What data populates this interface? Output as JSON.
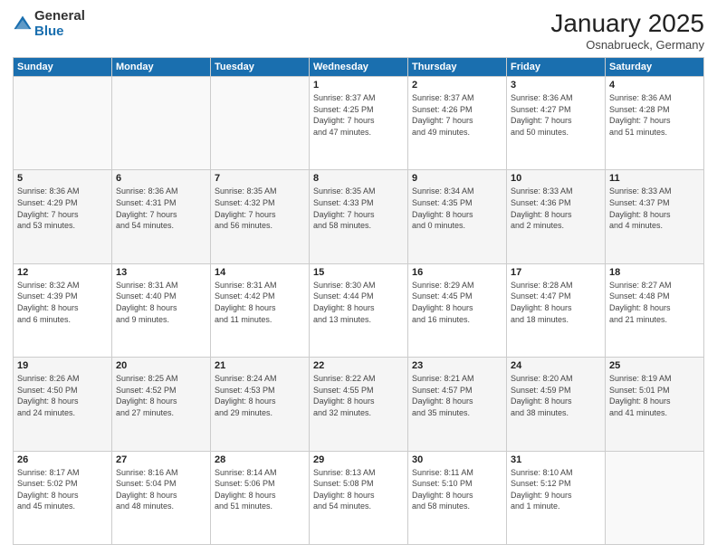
{
  "logo": {
    "general": "General",
    "blue": "Blue"
  },
  "title": "January 2025",
  "location": "Osnabrueck, Germany",
  "days_header": [
    "Sunday",
    "Monday",
    "Tuesday",
    "Wednesday",
    "Thursday",
    "Friday",
    "Saturday"
  ],
  "weeks": [
    [
      {
        "day": "",
        "info": ""
      },
      {
        "day": "",
        "info": ""
      },
      {
        "day": "",
        "info": ""
      },
      {
        "day": "1",
        "info": "Sunrise: 8:37 AM\nSunset: 4:25 PM\nDaylight: 7 hours\nand 47 minutes."
      },
      {
        "day": "2",
        "info": "Sunrise: 8:37 AM\nSunset: 4:26 PM\nDaylight: 7 hours\nand 49 minutes."
      },
      {
        "day": "3",
        "info": "Sunrise: 8:36 AM\nSunset: 4:27 PM\nDaylight: 7 hours\nand 50 minutes."
      },
      {
        "day": "4",
        "info": "Sunrise: 8:36 AM\nSunset: 4:28 PM\nDaylight: 7 hours\nand 51 minutes."
      }
    ],
    [
      {
        "day": "5",
        "info": "Sunrise: 8:36 AM\nSunset: 4:29 PM\nDaylight: 7 hours\nand 53 minutes."
      },
      {
        "day": "6",
        "info": "Sunrise: 8:36 AM\nSunset: 4:31 PM\nDaylight: 7 hours\nand 54 minutes."
      },
      {
        "day": "7",
        "info": "Sunrise: 8:35 AM\nSunset: 4:32 PM\nDaylight: 7 hours\nand 56 minutes."
      },
      {
        "day": "8",
        "info": "Sunrise: 8:35 AM\nSunset: 4:33 PM\nDaylight: 7 hours\nand 58 minutes."
      },
      {
        "day": "9",
        "info": "Sunrise: 8:34 AM\nSunset: 4:35 PM\nDaylight: 8 hours\nand 0 minutes."
      },
      {
        "day": "10",
        "info": "Sunrise: 8:33 AM\nSunset: 4:36 PM\nDaylight: 8 hours\nand 2 minutes."
      },
      {
        "day": "11",
        "info": "Sunrise: 8:33 AM\nSunset: 4:37 PM\nDaylight: 8 hours\nand 4 minutes."
      }
    ],
    [
      {
        "day": "12",
        "info": "Sunrise: 8:32 AM\nSunset: 4:39 PM\nDaylight: 8 hours\nand 6 minutes."
      },
      {
        "day": "13",
        "info": "Sunrise: 8:31 AM\nSunset: 4:40 PM\nDaylight: 8 hours\nand 9 minutes."
      },
      {
        "day": "14",
        "info": "Sunrise: 8:31 AM\nSunset: 4:42 PM\nDaylight: 8 hours\nand 11 minutes."
      },
      {
        "day": "15",
        "info": "Sunrise: 8:30 AM\nSunset: 4:44 PM\nDaylight: 8 hours\nand 13 minutes."
      },
      {
        "day": "16",
        "info": "Sunrise: 8:29 AM\nSunset: 4:45 PM\nDaylight: 8 hours\nand 16 minutes."
      },
      {
        "day": "17",
        "info": "Sunrise: 8:28 AM\nSunset: 4:47 PM\nDaylight: 8 hours\nand 18 minutes."
      },
      {
        "day": "18",
        "info": "Sunrise: 8:27 AM\nSunset: 4:48 PM\nDaylight: 8 hours\nand 21 minutes."
      }
    ],
    [
      {
        "day": "19",
        "info": "Sunrise: 8:26 AM\nSunset: 4:50 PM\nDaylight: 8 hours\nand 24 minutes."
      },
      {
        "day": "20",
        "info": "Sunrise: 8:25 AM\nSunset: 4:52 PM\nDaylight: 8 hours\nand 27 minutes."
      },
      {
        "day": "21",
        "info": "Sunrise: 8:24 AM\nSunset: 4:53 PM\nDaylight: 8 hours\nand 29 minutes."
      },
      {
        "day": "22",
        "info": "Sunrise: 8:22 AM\nSunset: 4:55 PM\nDaylight: 8 hours\nand 32 minutes."
      },
      {
        "day": "23",
        "info": "Sunrise: 8:21 AM\nSunset: 4:57 PM\nDaylight: 8 hours\nand 35 minutes."
      },
      {
        "day": "24",
        "info": "Sunrise: 8:20 AM\nSunset: 4:59 PM\nDaylight: 8 hours\nand 38 minutes."
      },
      {
        "day": "25",
        "info": "Sunrise: 8:19 AM\nSunset: 5:01 PM\nDaylight: 8 hours\nand 41 minutes."
      }
    ],
    [
      {
        "day": "26",
        "info": "Sunrise: 8:17 AM\nSunset: 5:02 PM\nDaylight: 8 hours\nand 45 minutes."
      },
      {
        "day": "27",
        "info": "Sunrise: 8:16 AM\nSunset: 5:04 PM\nDaylight: 8 hours\nand 48 minutes."
      },
      {
        "day": "28",
        "info": "Sunrise: 8:14 AM\nSunset: 5:06 PM\nDaylight: 8 hours\nand 51 minutes."
      },
      {
        "day": "29",
        "info": "Sunrise: 8:13 AM\nSunset: 5:08 PM\nDaylight: 8 hours\nand 54 minutes."
      },
      {
        "day": "30",
        "info": "Sunrise: 8:11 AM\nSunset: 5:10 PM\nDaylight: 8 hours\nand 58 minutes."
      },
      {
        "day": "31",
        "info": "Sunrise: 8:10 AM\nSunset: 5:12 PM\nDaylight: 9 hours\nand 1 minute."
      },
      {
        "day": "",
        "info": ""
      }
    ]
  ]
}
